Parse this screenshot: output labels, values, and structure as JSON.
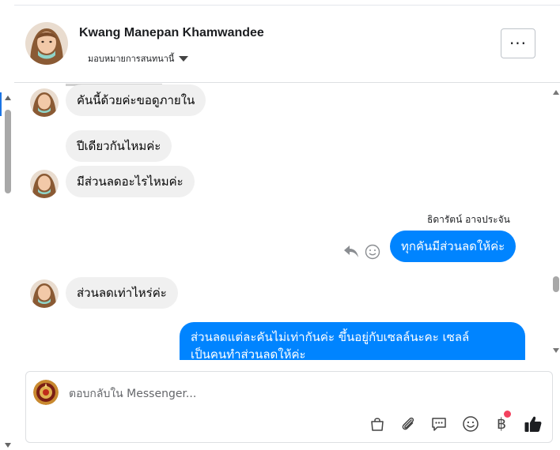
{
  "header": {
    "contact_name": "Kwang Manepan Khamwandee",
    "assign_label": "มอบหมายการสนทนานี้",
    "more_label": "···"
  },
  "messages": [
    {
      "id": 1,
      "direction": "incoming",
      "text": "คันนี้ด้วยค่ะขอดูภายใน",
      "avatar": true
    },
    {
      "id": 2,
      "direction": "incoming",
      "text": "ปีเดียวกันไหมค่ะ",
      "avatar": false
    },
    {
      "id": 3,
      "direction": "incoming",
      "text": "มีส่วนลดอะไรไหมค่ะ",
      "avatar": true
    },
    {
      "id": 4,
      "direction": "outgoing",
      "sender": "ธิดารัตน์ อาจประจัน",
      "text": "ทุกคันมีส่วนลดให้ค่ะ"
    },
    {
      "id": 5,
      "direction": "incoming",
      "text": "ส่วนลดเท่าไหร่ค่ะ",
      "avatar": true
    },
    {
      "id": 6,
      "direction": "outgoing",
      "lines": [
        "ส่วนลดแต่ละคันไม่เท่ากันค่ะ ขึ้นอยู่กับเซลล์นะคะ เซลล์",
        "เป็นคนทำส่วนลดให้ค่ะ"
      ]
    }
  ],
  "composer": {
    "placeholder": "ตอบกลับใน Messenger..."
  },
  "toolbar_icons": [
    "bag-icon",
    "paperclip-icon",
    "saved-replies-icon",
    "emoji-icon",
    "baht-icon",
    "like-icon"
  ],
  "baht_symbol": "฿",
  "colors": {
    "outgoing_bubble": "#0084ff",
    "incoming_bubble": "#f0f0f0",
    "notification_dot": "#f3425f",
    "accent": "#1b74e4"
  }
}
